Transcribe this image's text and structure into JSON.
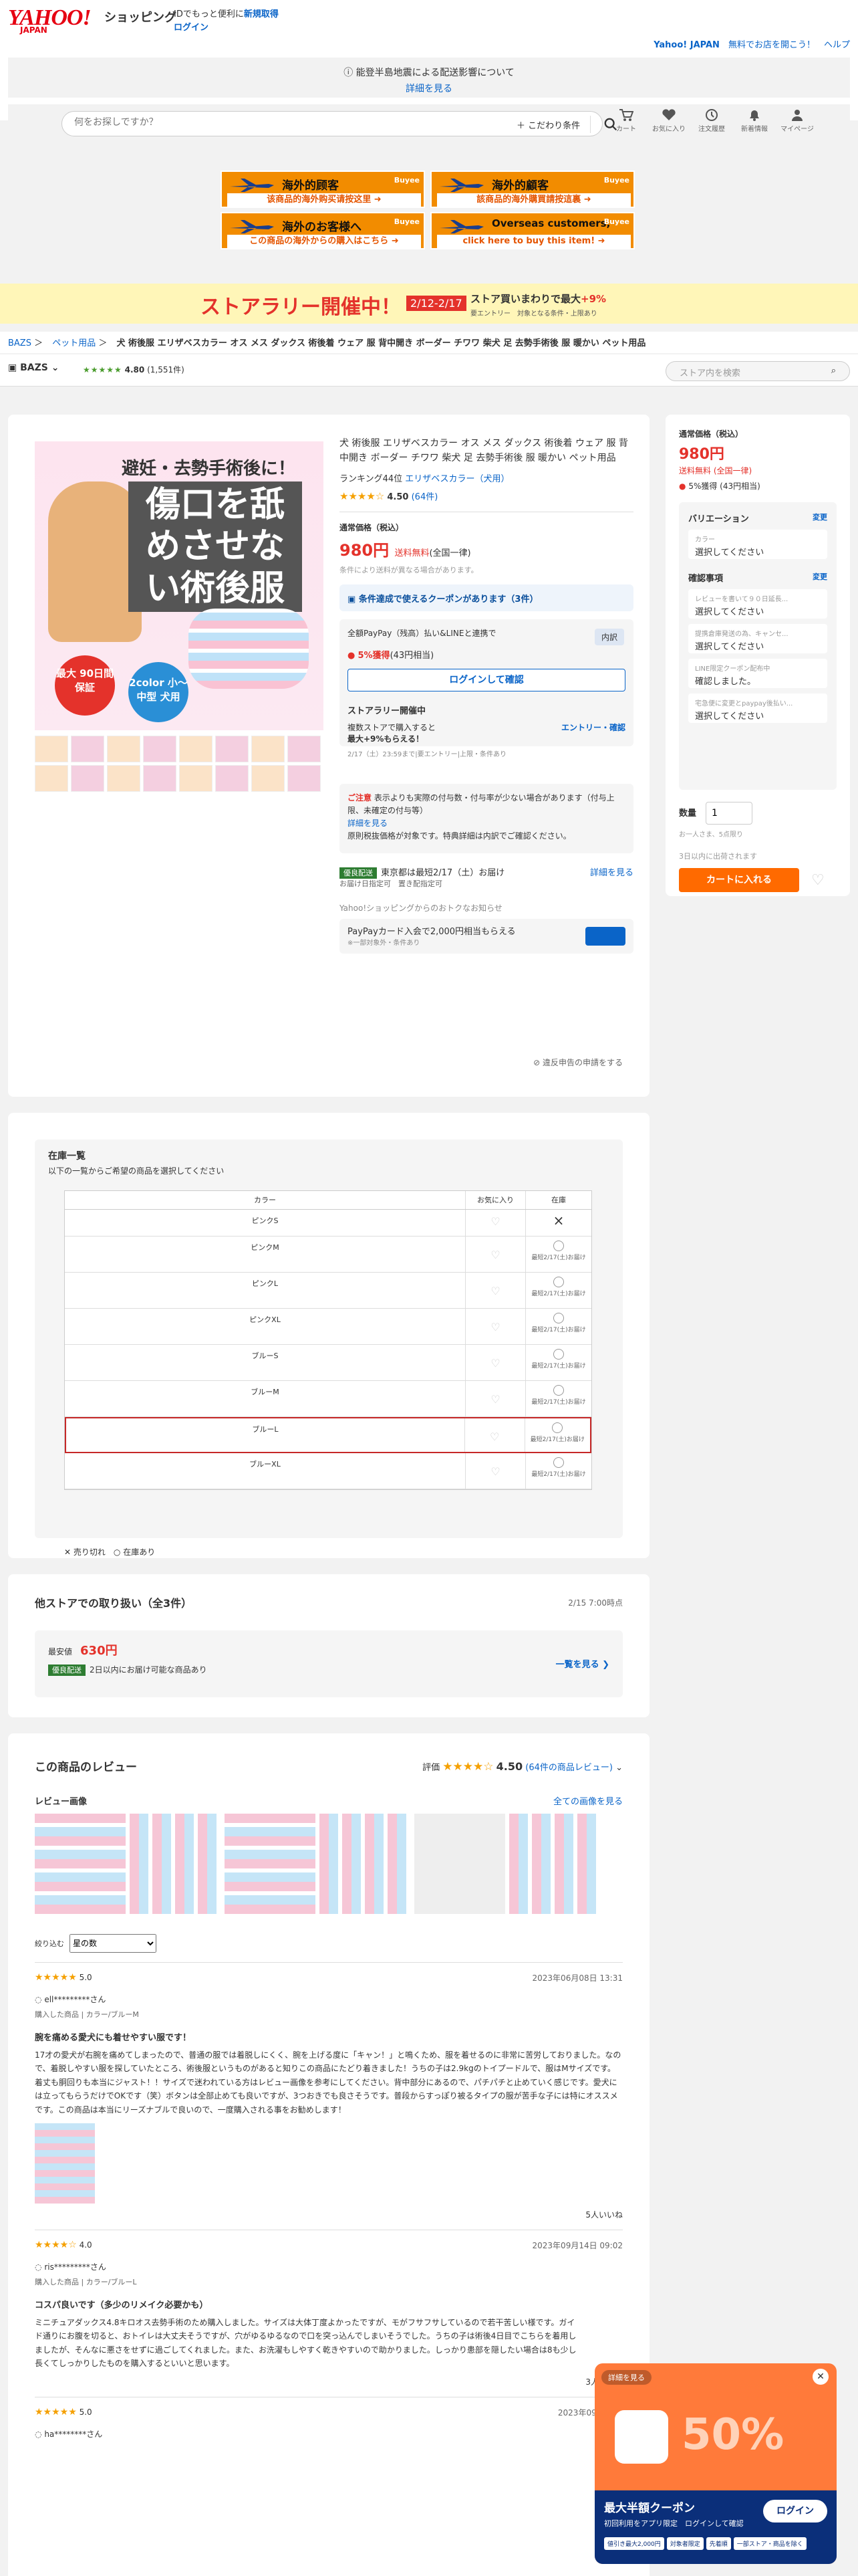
{
  "header": {
    "logo": "YAHOO!",
    "logo_sub": "JAPAN",
    "shopping": "ショッピング",
    "id_text": "IDでもっと便利に",
    "signup": "新規取得",
    "login": "ログイン",
    "yahoo_japan": "Yahoo! JAPAN",
    "yahoo_link": "無料でお店を開こう！",
    "help": "ヘルプ"
  },
  "notice": {
    "text": "能登半島地震による配送影響について",
    "more": "詳細を見る"
  },
  "search": {
    "placeholder": "何をお探しですか？",
    "conditions": "こだわり条件"
  },
  "nav": [
    {
      "label": "カート",
      "icon": "cart-icon"
    },
    {
      "label": "お気に入り",
      "icon": "heart-icon"
    },
    {
      "label": "注文履歴",
      "icon": "history-icon"
    },
    {
      "label": "新着情報",
      "icon": "bell-icon"
    },
    {
      "label": "マイページ",
      "icon": "person-icon"
    }
  ],
  "banners": [
    {
      "title": "海外的顾客",
      "sub": "该商品的海外购买请按这里 ➜",
      "brand": "Buyee"
    },
    {
      "title": "海外的顧客",
      "sub": "該商品的海外購買請按這裏 ➜",
      "brand": "Buyee"
    },
    {
      "title": "海外のお客様へ",
      "sub": "この商品の海外からの購入はこちら ➜",
      "brand": "Buyee"
    },
    {
      "title": "Overseas customers,",
      "sub": "click here to buy this item! ➜",
      "brand": "Buyee"
    }
  ],
  "rally": {
    "title": "ストアラリー開催中！",
    "date": "2/12-2/17",
    "line1_pre": "ストア買いまわりで最大",
    "line1_pct": "+9%",
    "line2": "要エントリー　対象となる条件・上限あり"
  },
  "breadcrumb": [
    "BAZS",
    "ペット用品",
    "犬 術後服 エリザベスカラー オス メス ダックス 術後着 ウェア 服 背中開き ボーダー チワワ 柴犬 足 去勢手術後 服 暖かい ペット用品"
  ],
  "store": {
    "name": "BAZS",
    "rating": "4.80",
    "count": "(1,551件)",
    "search_placeholder": "ストア内を検索"
  },
  "image": {
    "headline": "避妊・去勢手術後に！",
    "main": "傷口を舐めさせない術後服",
    "badge1": "最大 90日間 保証",
    "badge2": "2color 小〜中型 犬用"
  },
  "product": {
    "title": "犬 術後服 エリザベスカラー オス メス ダックス 術後着 ウェア 服 背中開き ボーダー チワワ 柴犬 足 去勢手術後 服 暖かい ペット用品",
    "ranking_pre": "ランキング44位",
    "ranking_link": "エリザベスカラー（犬用）",
    "rating": "4.50",
    "reviews": "(64件)",
    "price_label": "通常価格（税込）",
    "price": "980円",
    "shipping": "送料無料",
    "shipping_note": "(全国一律)",
    "price_note": "条件により送料が異なる場合があります。",
    "coupon": "条件達成で使えるクーポンがあります（3件）",
    "paypay_line": "全額PayPay（残高）払い&LINEと連携で",
    "uchiwake": "内訳",
    "points": "5%獲得",
    "points_note": "(43円相当)",
    "login_btn": "ログインして確認",
    "rally_title": "ストアラリー開催中",
    "rally_line1": "複数ストアで購入すると",
    "rally_line2": "最大+9%もらえる！",
    "rally_entry": "エントリー・確認",
    "rally_note": "2/17（土）23:59まで|要エントリー|上限・条件あり",
    "caution_title": "ご注意",
    "caution_text": "表示よりも実際の付与数・付与率が少ない場合があります（付与上限、未確定の付与等）",
    "caution_more": "詳細を見る",
    "caution_note": "原則税抜価格が対象です。特典詳細は内訳でご確認ください。",
    "ship_tag": "優良配送",
    "ship_text": "東京都は最短2/17（土）お届け",
    "ship_sub": "お届け日指定可　置き配指定可",
    "ship_more": "詳細を見る",
    "pp_head": "Yahoo!ショッピングからのおトクなお知らせ",
    "pp_text": "PayPayカード入会で2,000円相当もらえる",
    "pp_sub": "※一部対象外・条件あり",
    "report": "違反申告の申請をする"
  },
  "side": {
    "price_label": "通常価格（税込）",
    "price": "980円",
    "shipping": "送料無料 (全国一律)",
    "points": "5%獲得 (43円相当)",
    "variation": "バリエーション",
    "change": "変更",
    "color_label": "カラー",
    "color_value": "選択してください",
    "confirm": "確認事項",
    "rows": [
      {
        "s": "レビューを書いて９０日延長...",
        "v": "選択してください"
      },
      {
        "s": "提携倉庫発送の為、キャンセ...",
        "v": "選択してください"
      },
      {
        "s": "LINE限定クーポン配布中",
        "v": "確認しました。"
      },
      {
        "s": "宅急便に変更とpaypay後払い...",
        "v": "選択してください"
      }
    ],
    "qty_label": "数量",
    "qty": "1",
    "qty_note": "お一人さま、5点限り",
    "cart_note": "3日以内に出荷されます",
    "cart": "カートに入れる"
  },
  "stock": {
    "title": "在庫一覧",
    "sub": "以下の一覧からご希望の商品を選択してください",
    "headers": [
      "カラー",
      "お気に入り",
      "在庫"
    ],
    "rows": [
      {
        "name": "ピンクS",
        "stock": "×"
      },
      {
        "name": "ピンクM",
        "stock": "最短2/17(土)お届け"
      },
      {
        "name": "ピンクL",
        "stock": "最短2/17(土)お届け"
      },
      {
        "name": "ピンクXL",
        "stock": "最短2/17(土)お届け"
      },
      {
        "name": "ブルーS",
        "stock": "最短2/17(土)お届け"
      },
      {
        "name": "ブルーM",
        "stock": "最短2/17(土)お届け"
      },
      {
        "name": "ブルーL",
        "stock": "最短2/17(土)お届け"
      },
      {
        "name": "ブルーXL",
        "stock": "最短2/17(土)お届け"
      }
    ],
    "legend_out": "売り切れ",
    "legend_in": "在庫あり"
  },
  "other": {
    "title": "他ストアでの取り扱い（全3件）",
    "date": "2/15 7:00時点",
    "lowest_label": "最安値",
    "lowest": "630円",
    "tag": "優良配送",
    "ship": "2日以内にお届け可能な商品あり",
    "more": "一覧を見る ❯"
  },
  "reviews": {
    "title": "この商品のレビュー",
    "label": "評価",
    "rating": "4.50",
    "count": "(64件の商品レビュー)",
    "images_label": "レビュー画像",
    "images_link": "全ての画像を見る",
    "filter_label": "絞り込む",
    "filter_value": "星の数",
    "items": [
      {
        "score": "5.0",
        "date": "2023年06月08日 13:31",
        "user": "ell*********さん",
        "meta": "購入した商品 | カラー/ブルーM",
        "title": "腕を痛める愛犬にも着せやすい服です！",
        "body": "17才の愛犬が右腕を痛めてしまったので、普通の服では着脱しにくく、腕を上げる度に「キャン！」と鳴くため、服を着せるのに非常に苦労しておりました。なので、着脱しやすい服を探していたところ、術後服というものがあると知りこの商品にたどり着きました！うちの子は2.9kgのトイプードルで、服はMサイズです。着丈も胴回りも本当にジャスト！！サイズで迷われている方はレビュー画像を参考にしてください。背中部分にあるので、パチパチと止めていく感じです。愛犬には立ってもらうだけでOKです（笑）ボタンは全部止めても良いですが、3つおきでも良さそうです。普段からすっぽり被るタイプの服が苦手な子には特にオススメです。この商品は本当にリーズナブルで良いので、一度購入される事をお勧めします！",
        "useful": "5人いいね"
      },
      {
        "score": "4.0",
        "date": "2023年09月14日 09:02",
        "user": "ris*********さん",
        "meta": "購入した商品 | カラー/ブルーL",
        "title": "コスパ良いです（多少のリメイク必要かも）",
        "body": "ミニチュアダックス4.8キロオス去勢手術のため購入しました。サイズは大体丁度よかったですが、モがフサフサしているので若干苦しい様です。ガイド通りにお腹を切ると、おトイレは大丈夫そうですが、穴がゆるゆるなので口を突っ込んでしまいそうでした。うちの子は術後4日目でこちらを着用しましたが、そんなに悪さをせずに過ごしてくれました。また、お洗濯もしやすく乾きやすいので助かりました。しっかり患部を隠したい場合は8も少し長くてしっかりしたものを購入するといいと思います。",
        "useful": "3人いいね"
      },
      {
        "score": "5.0",
        "date": "2023年09月02日",
        "user": "ha********さん",
        "meta": "",
        "title": "",
        "body": "",
        "useful": ""
      }
    ]
  },
  "popup": {
    "tag": "詳細を見る",
    "big": "50%",
    "title": "最大半額クーポン",
    "sub": "初回利用をアプリ限定　ログインして確認",
    "login": "ログイン",
    "chips": [
      "値引き最大2,000円",
      "対象者限定",
      "先着順",
      "一部ストア・商品を除く"
    ]
  }
}
